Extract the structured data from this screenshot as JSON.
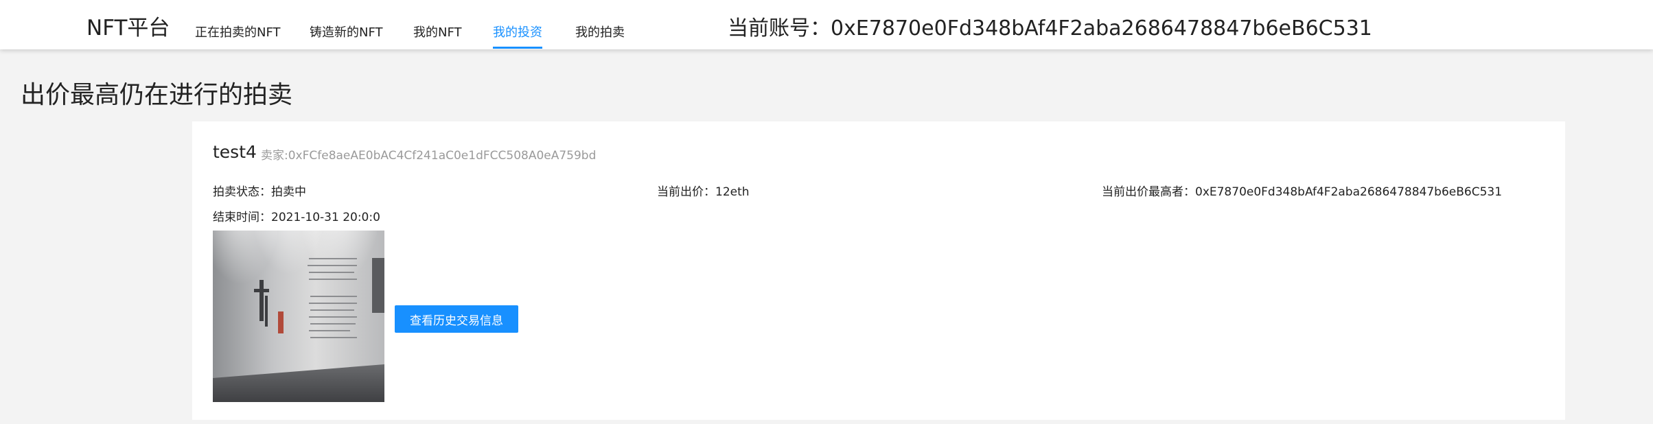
{
  "header": {
    "logo": "NFT平台",
    "nav": [
      {
        "label": "正在拍卖的NFT",
        "active": false
      },
      {
        "label": "铸造新的NFT",
        "active": false
      },
      {
        "label": "我的NFT",
        "active": false
      },
      {
        "label": "我的投资",
        "active": true
      },
      {
        "label": "我的拍卖",
        "active": false
      }
    ],
    "account_label": "当前账号：",
    "account_value": "0xE7870e0Fd348bAf4F2aba2686478847b6eB6C531"
  },
  "main": {
    "section_title": "出价最高仍在进行的拍卖",
    "auction": {
      "name": "test4",
      "seller_label": "卖家:",
      "seller": "0xFCfe8aeAE0bAC4Cf241aC0e1dFCC508A0eA759bd",
      "status_label": "拍卖状态：",
      "status": "拍卖中",
      "price_label": "当前出价：",
      "price": "12eth",
      "top_bidder_label": "当前出价最高者：",
      "top_bidder": "0xE7870e0Fd348bAf4F2aba2686478847b6eB6C531",
      "end_time_label": "结束时间：",
      "end_time": "2021-10-31 20:0:0",
      "history_button": "查看历史交易信息"
    }
  },
  "colors": {
    "accent": "#1890ff",
    "background": "#f3f3f3",
    "card": "#ffffff",
    "muted_text": "#9a9a9a"
  }
}
